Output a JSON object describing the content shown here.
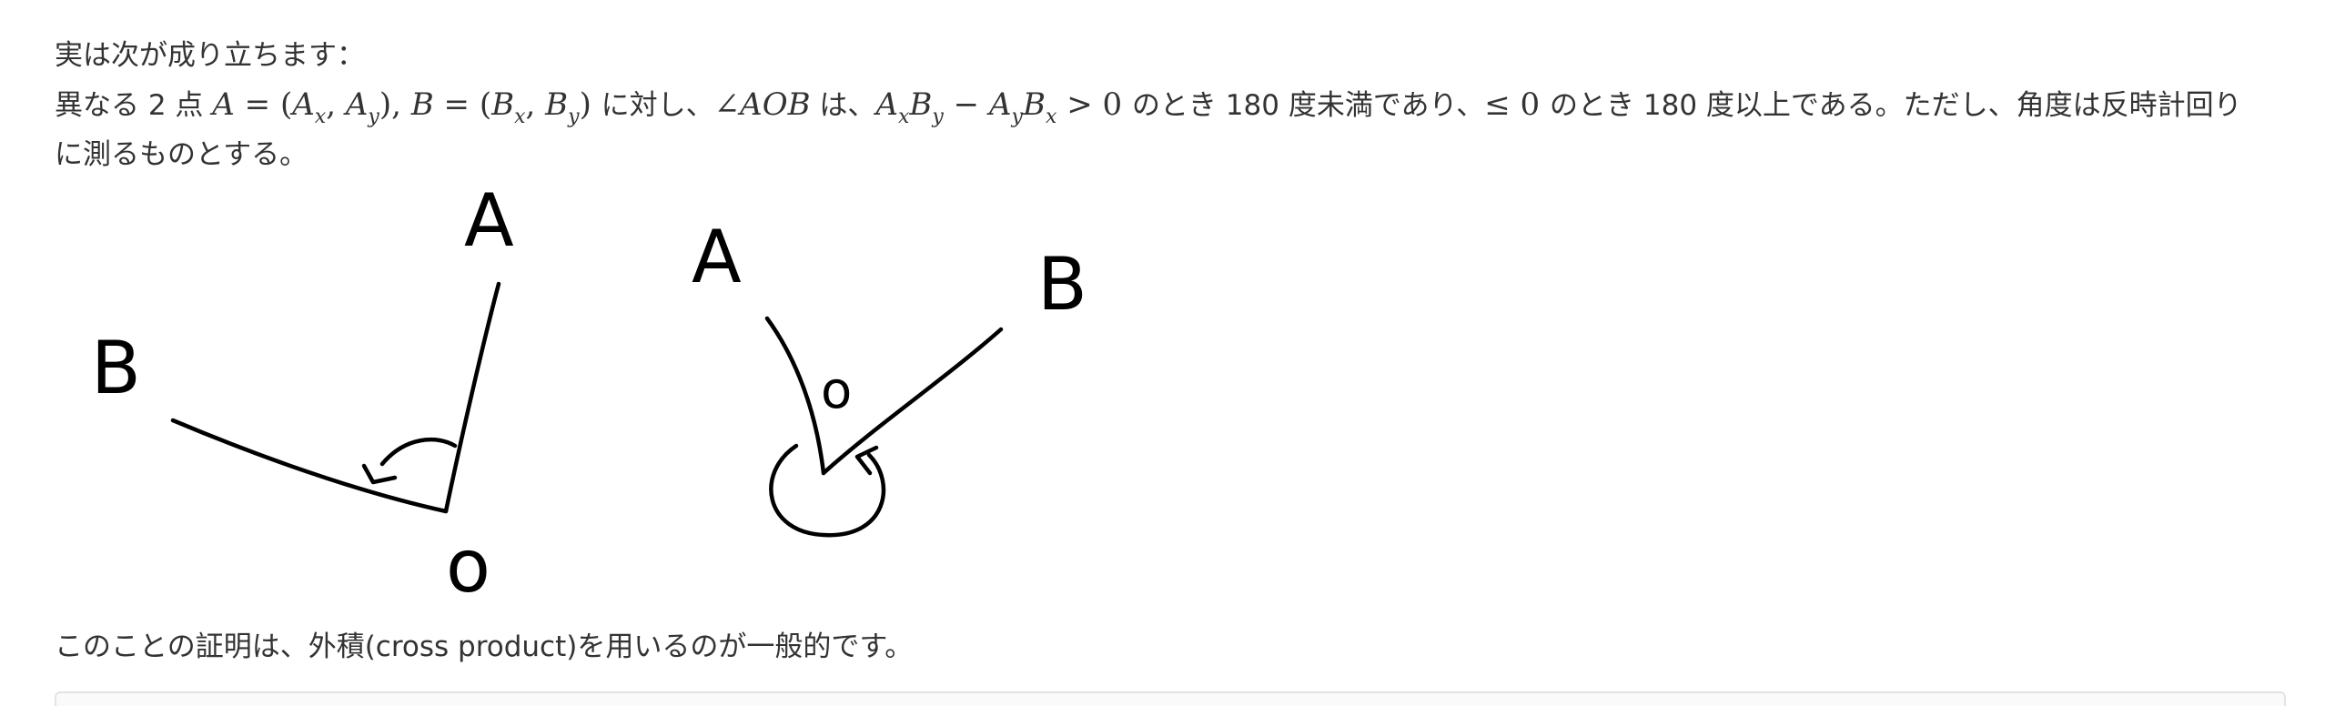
{
  "paragraphs": {
    "intro": "実は次が成り立ちます：",
    "statement": {
      "t1": "異なる 2 点 ",
      "A": "A",
      "eq": " = (",
      "Ax": "A",
      "x": "x",
      "comma": ", ",
      "Ay": "A",
      "y": "y",
      "close": "), ",
      "B": "B",
      "eq2": " = (",
      "Bx": "B",
      "close2": ") ",
      "t2": "に対し、",
      "angle": "∠AOB",
      "t3": " は、",
      "minus": " − ",
      "gt": " > 0 ",
      "t4": "のとき 180 度未満であり、",
      "le": "≤ 0 ",
      "t5": "のとき 180 度以上である。ただし、角度は反時計回り"
    },
    "statement_cont": "に測るものとする。",
    "conclusion": "このことの証明は、外積(cross product)を用いるのが一般的です。"
  },
  "figure": {
    "left_labels": {
      "A": "A",
      "B": "B",
      "O": "o"
    },
    "right_labels": {
      "A": "A",
      "B": "B",
      "O": "o"
    }
  }
}
